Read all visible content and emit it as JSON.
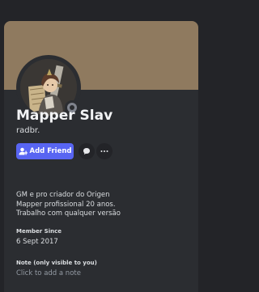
{
  "profile": {
    "display_name": "Mapper Slav",
    "username": "radbr.",
    "status": "offline",
    "banner_color": "#8f7a5f"
  },
  "actions": {
    "add_friend_label": "Add Friend",
    "message_icon": "chat-bubble-icon",
    "more_icon": "more-options-icon"
  },
  "bio": {
    "lines": [
      "GM e pro criador do Origen",
      "Mapper profissional 20 anos.",
      "Trabalho com qualquer versão"
    ]
  },
  "member_since": {
    "title": "Member Since",
    "date": "6 Sept 2017"
  },
  "note": {
    "title": "Note (only visible to you)",
    "placeholder": "Click to add a note"
  }
}
